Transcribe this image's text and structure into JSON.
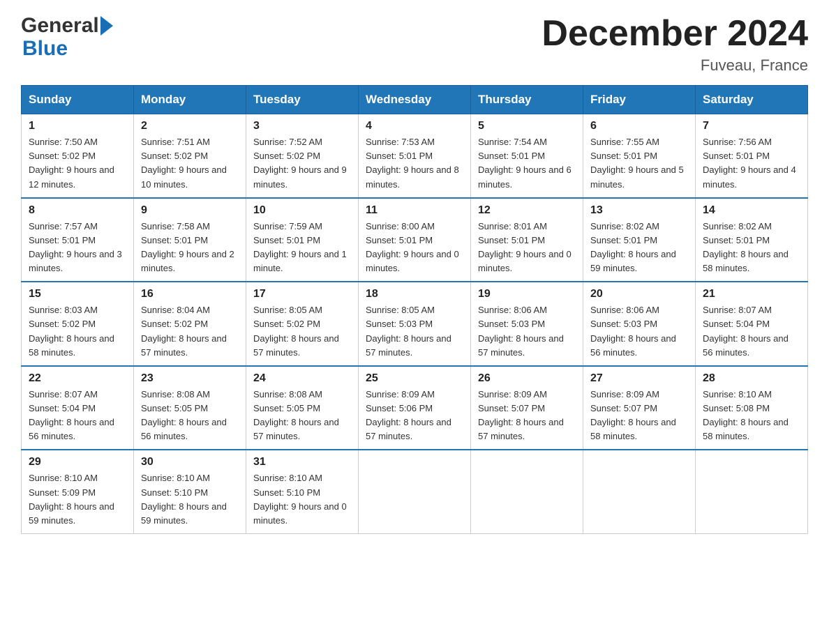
{
  "header": {
    "logo_general": "General",
    "logo_blue": "Blue",
    "month_title": "December 2024",
    "location": "Fuveau, France"
  },
  "days_of_week": [
    "Sunday",
    "Monday",
    "Tuesday",
    "Wednesday",
    "Thursday",
    "Friday",
    "Saturday"
  ],
  "weeks": [
    [
      {
        "day": "1",
        "sunrise": "7:50 AM",
        "sunset": "5:02 PM",
        "daylight": "9 hours and 12 minutes."
      },
      {
        "day": "2",
        "sunrise": "7:51 AM",
        "sunset": "5:02 PM",
        "daylight": "9 hours and 10 minutes."
      },
      {
        "day": "3",
        "sunrise": "7:52 AM",
        "sunset": "5:02 PM",
        "daylight": "9 hours and 9 minutes."
      },
      {
        "day": "4",
        "sunrise": "7:53 AM",
        "sunset": "5:01 PM",
        "daylight": "9 hours and 8 minutes."
      },
      {
        "day": "5",
        "sunrise": "7:54 AM",
        "sunset": "5:01 PM",
        "daylight": "9 hours and 6 minutes."
      },
      {
        "day": "6",
        "sunrise": "7:55 AM",
        "sunset": "5:01 PM",
        "daylight": "9 hours and 5 minutes."
      },
      {
        "day": "7",
        "sunrise": "7:56 AM",
        "sunset": "5:01 PM",
        "daylight": "9 hours and 4 minutes."
      }
    ],
    [
      {
        "day": "8",
        "sunrise": "7:57 AM",
        "sunset": "5:01 PM",
        "daylight": "9 hours and 3 minutes."
      },
      {
        "day": "9",
        "sunrise": "7:58 AM",
        "sunset": "5:01 PM",
        "daylight": "9 hours and 2 minutes."
      },
      {
        "day": "10",
        "sunrise": "7:59 AM",
        "sunset": "5:01 PM",
        "daylight": "9 hours and 1 minute."
      },
      {
        "day": "11",
        "sunrise": "8:00 AM",
        "sunset": "5:01 PM",
        "daylight": "9 hours and 0 minutes."
      },
      {
        "day": "12",
        "sunrise": "8:01 AM",
        "sunset": "5:01 PM",
        "daylight": "9 hours and 0 minutes."
      },
      {
        "day": "13",
        "sunrise": "8:02 AM",
        "sunset": "5:01 PM",
        "daylight": "8 hours and 59 minutes."
      },
      {
        "day": "14",
        "sunrise": "8:02 AM",
        "sunset": "5:01 PM",
        "daylight": "8 hours and 58 minutes."
      }
    ],
    [
      {
        "day": "15",
        "sunrise": "8:03 AM",
        "sunset": "5:02 PM",
        "daylight": "8 hours and 58 minutes."
      },
      {
        "day": "16",
        "sunrise": "8:04 AM",
        "sunset": "5:02 PM",
        "daylight": "8 hours and 57 minutes."
      },
      {
        "day": "17",
        "sunrise": "8:05 AM",
        "sunset": "5:02 PM",
        "daylight": "8 hours and 57 minutes."
      },
      {
        "day": "18",
        "sunrise": "8:05 AM",
        "sunset": "5:03 PM",
        "daylight": "8 hours and 57 minutes."
      },
      {
        "day": "19",
        "sunrise": "8:06 AM",
        "sunset": "5:03 PM",
        "daylight": "8 hours and 57 minutes."
      },
      {
        "day": "20",
        "sunrise": "8:06 AM",
        "sunset": "5:03 PM",
        "daylight": "8 hours and 56 minutes."
      },
      {
        "day": "21",
        "sunrise": "8:07 AM",
        "sunset": "5:04 PM",
        "daylight": "8 hours and 56 minutes."
      }
    ],
    [
      {
        "day": "22",
        "sunrise": "8:07 AM",
        "sunset": "5:04 PM",
        "daylight": "8 hours and 56 minutes."
      },
      {
        "day": "23",
        "sunrise": "8:08 AM",
        "sunset": "5:05 PM",
        "daylight": "8 hours and 56 minutes."
      },
      {
        "day": "24",
        "sunrise": "8:08 AM",
        "sunset": "5:05 PM",
        "daylight": "8 hours and 57 minutes."
      },
      {
        "day": "25",
        "sunrise": "8:09 AM",
        "sunset": "5:06 PM",
        "daylight": "8 hours and 57 minutes."
      },
      {
        "day": "26",
        "sunrise": "8:09 AM",
        "sunset": "5:07 PM",
        "daylight": "8 hours and 57 minutes."
      },
      {
        "day": "27",
        "sunrise": "8:09 AM",
        "sunset": "5:07 PM",
        "daylight": "8 hours and 58 minutes."
      },
      {
        "day": "28",
        "sunrise": "8:10 AM",
        "sunset": "5:08 PM",
        "daylight": "8 hours and 58 minutes."
      }
    ],
    [
      {
        "day": "29",
        "sunrise": "8:10 AM",
        "sunset": "5:09 PM",
        "daylight": "8 hours and 59 minutes."
      },
      {
        "day": "30",
        "sunrise": "8:10 AM",
        "sunset": "5:10 PM",
        "daylight": "8 hours and 59 minutes."
      },
      {
        "day": "31",
        "sunrise": "8:10 AM",
        "sunset": "5:10 PM",
        "daylight": "9 hours and 0 minutes."
      },
      null,
      null,
      null,
      null
    ]
  ],
  "labels": {
    "sunrise": "Sunrise:",
    "sunset": "Sunset:",
    "daylight": "Daylight:"
  },
  "colors": {
    "header_bg": "#2176b8",
    "header_text": "#ffffff",
    "border": "#2176b8"
  }
}
